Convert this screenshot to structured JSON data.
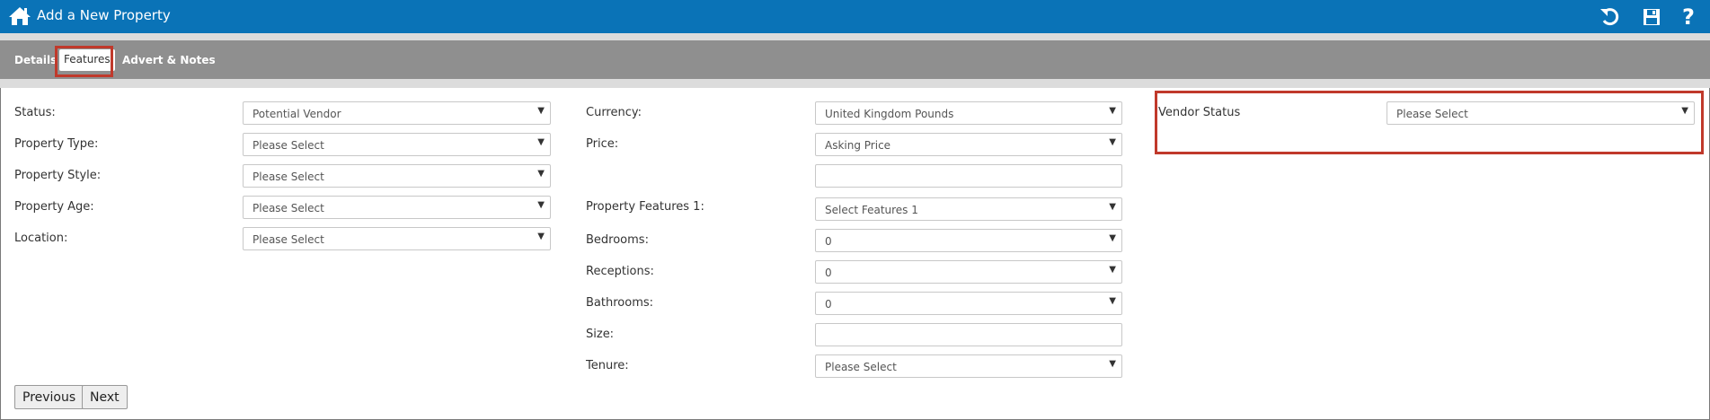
{
  "colors": {
    "header_bg": "#0a73b7",
    "tabbar_bg": "#8f8f8f",
    "highlight": "#c0392b"
  },
  "header": {
    "title": "Add a New Property",
    "icons": [
      "home-icon",
      "undo-icon",
      "save-icon",
      "help-icon"
    ],
    "help_glyph": "?"
  },
  "tabs": [
    {
      "label": "Details",
      "selected": false
    },
    {
      "label": "Features",
      "selected": true
    },
    {
      "label": "Advert & Notes",
      "selected": false
    }
  ],
  "form": {
    "status": {
      "label": "Status:",
      "value": "Potential Vendor"
    },
    "property_type": {
      "label": "Property Type:",
      "value": "Please Select"
    },
    "property_style": {
      "label": "Property Style:",
      "value": "Please Select"
    },
    "property_age": {
      "label": "Property Age:",
      "value": "Please Select"
    },
    "location": {
      "label": "Location:",
      "value": "Please Select"
    },
    "currency": {
      "label": "Currency:",
      "value": "United Kingdom Pounds"
    },
    "price": {
      "label": "Price:",
      "value": "Asking Price",
      "amount": ""
    },
    "property_features_1": {
      "label": "Property Features 1:",
      "value": "Select Features 1"
    },
    "bedrooms": {
      "label": "Bedrooms:",
      "value": "0"
    },
    "receptions": {
      "label": "Receptions:",
      "value": "0"
    },
    "bathrooms": {
      "label": "Bathrooms:",
      "value": "0"
    },
    "size": {
      "label": "Size:",
      "value": ""
    },
    "tenure": {
      "label": "Tenure:",
      "value": "Please Select"
    },
    "vendor_status": {
      "label": "Vendor Status",
      "value": "Please Select"
    }
  },
  "buttons": {
    "previous": "Previous",
    "next": "Next"
  },
  "arrow_glyph": "▼"
}
